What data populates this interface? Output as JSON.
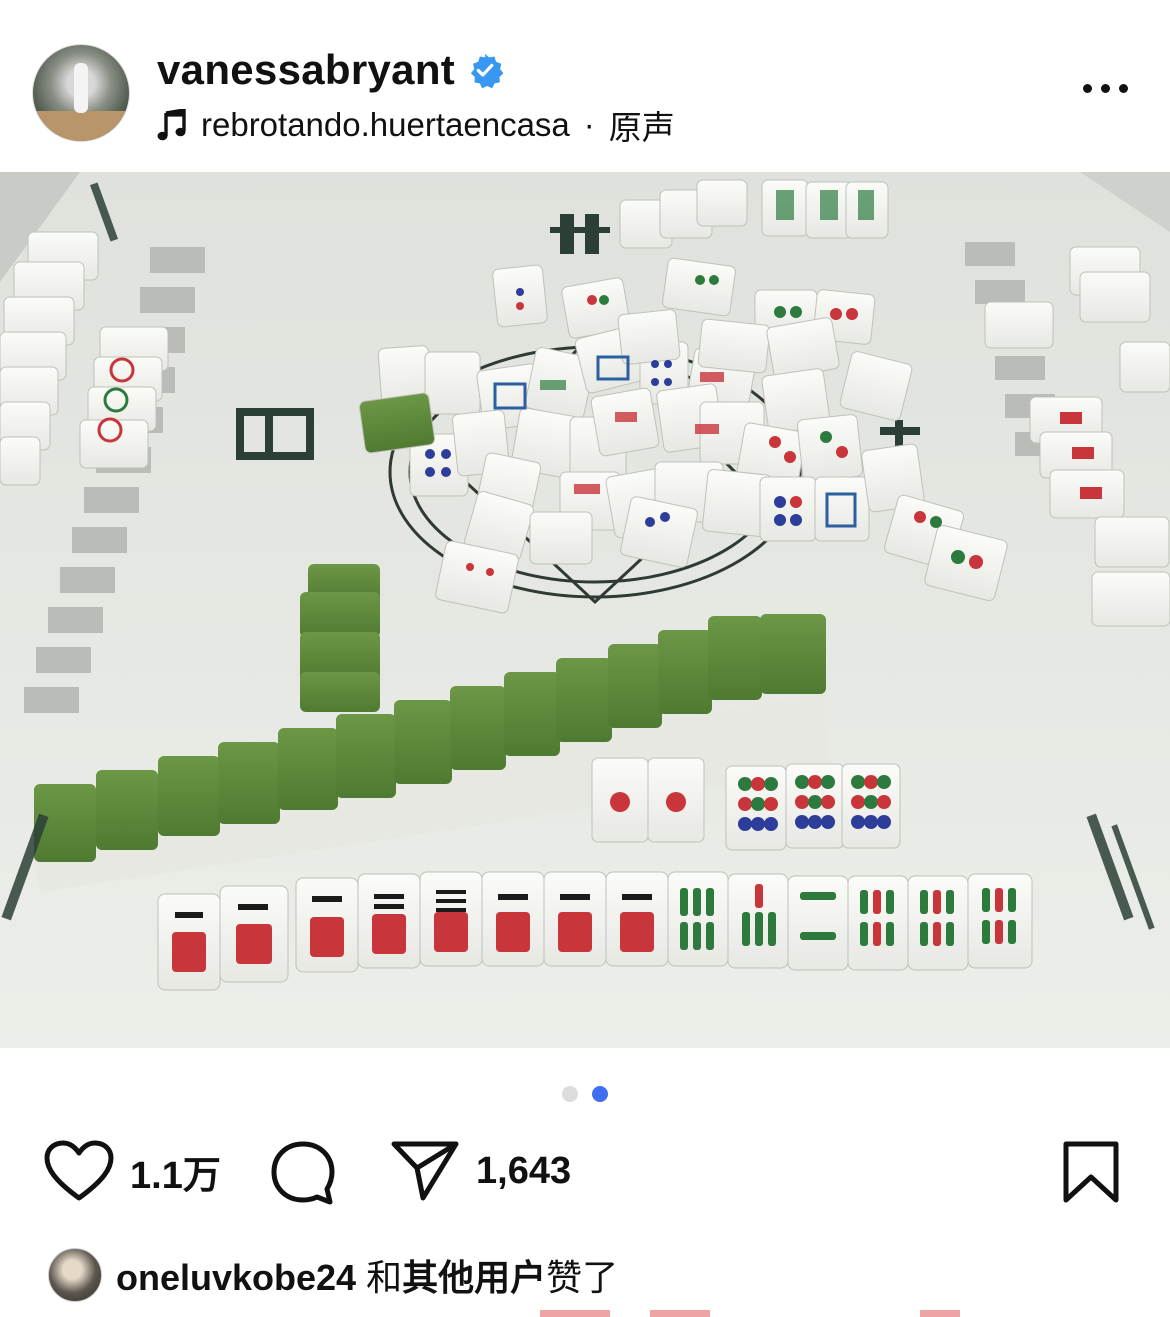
{
  "header": {
    "username": "vanessabryant",
    "audio_source": "rebrotando.huertaencasa",
    "audio_separator": "·",
    "audio_label": "原声"
  },
  "media": {
    "icons": {
      "sound": "volume-icon"
    }
  },
  "carousel": {
    "count": 2,
    "active_index": 1
  },
  "actions": {
    "like_count": "1.1万",
    "share_count": "1,643"
  },
  "likes": {
    "user": "oneluvkobe24",
    "connector": "和",
    "others": "其他用户",
    "suffix": "赞了"
  },
  "colors": {
    "verified": "#3897f0",
    "active_dot": "#3f6ef0",
    "tile_back": "#5f8a3c",
    "table_mat": "#e4e6e1"
  }
}
